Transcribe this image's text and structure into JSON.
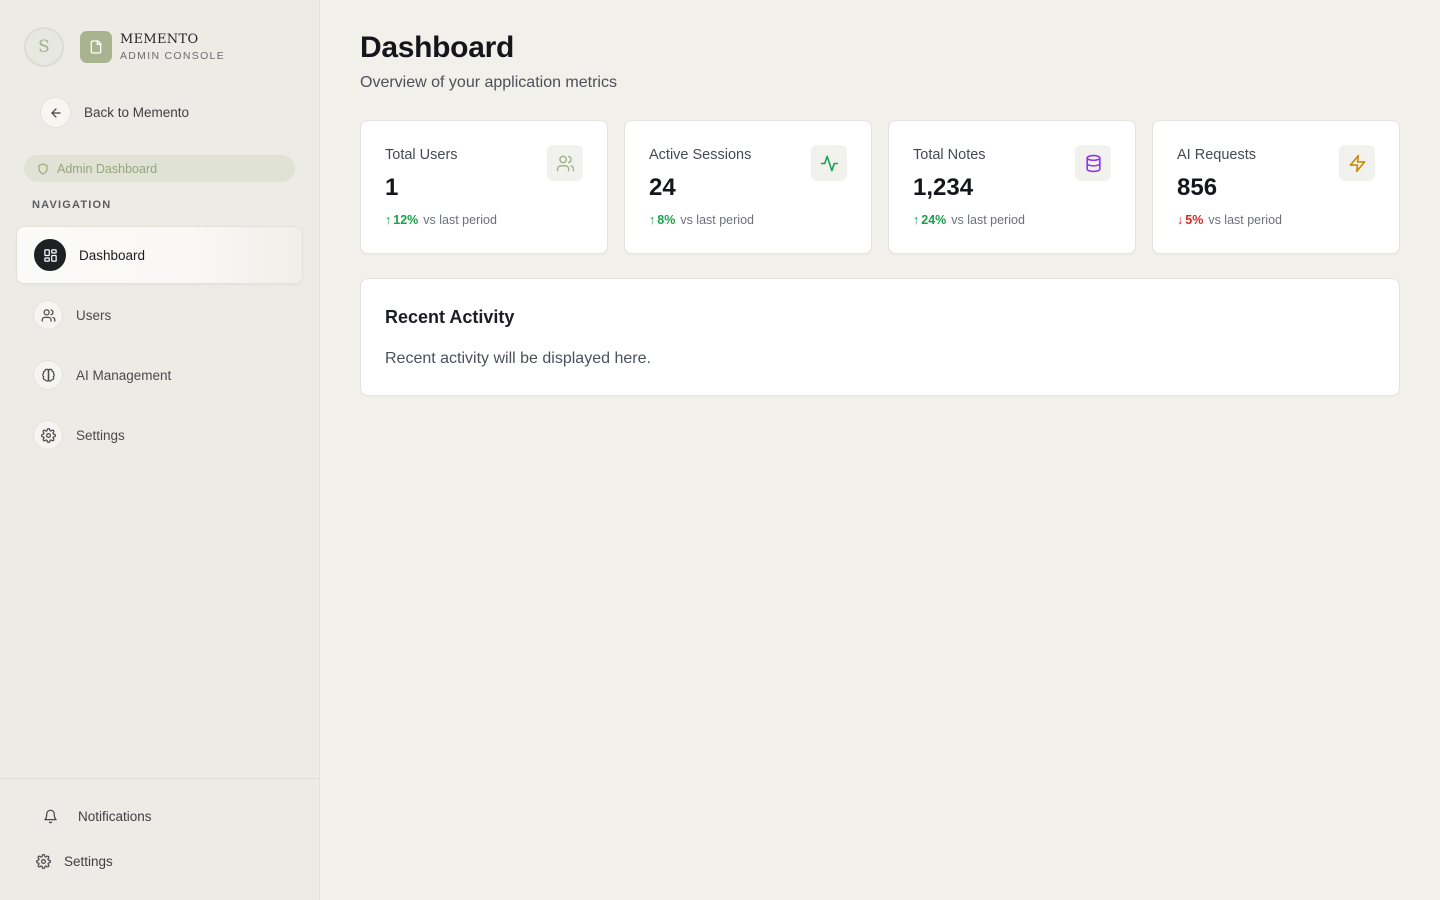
{
  "brand": {
    "avatar_initial": "S",
    "name": "MEMENTO",
    "subtitle": "ADMIN CONSOLE"
  },
  "sidebar": {
    "back_label": "Back to Memento",
    "admin_pill_label": "Admin Dashboard",
    "nav_heading": "NAVIGATION",
    "items": [
      {
        "label": "Dashboard",
        "icon": "dashboard-icon",
        "active": true
      },
      {
        "label": "Users",
        "icon": "users-icon",
        "active": false
      },
      {
        "label": "AI Management",
        "icon": "brain-icon",
        "active": false
      },
      {
        "label": "Settings",
        "icon": "gear-icon",
        "active": false
      }
    ],
    "footer": {
      "notifications_label": "Notifications",
      "settings_label": "Settings"
    }
  },
  "main": {
    "title": "Dashboard",
    "subtitle": "Overview of your application metrics",
    "stats": [
      {
        "label": "Total Users",
        "value": "1",
        "change": "12%",
        "direction": "up",
        "period": "vs last period",
        "icon": "users-icon",
        "icon_color": "#a2b08d"
      },
      {
        "label": "Active Sessions",
        "value": "24",
        "change": "8%",
        "direction": "up",
        "period": "vs last period",
        "icon": "activity-icon",
        "icon_color": "#16a34a"
      },
      {
        "label": "Total Notes",
        "value": "1,234",
        "change": "24%",
        "direction": "up",
        "period": "vs last period",
        "icon": "database-icon",
        "icon_color": "#9333ea"
      },
      {
        "label": "AI Requests",
        "value": "856",
        "change": "5%",
        "direction": "down",
        "period": "vs last period",
        "icon": "lightning-icon",
        "icon_color": "#ca8a04"
      }
    ],
    "activity": {
      "title": "Recent Activity",
      "body": "Recent activity will be displayed here."
    }
  },
  "colors": {
    "up": "#16a34a",
    "down": "#dc2626",
    "accent": "#a7b48f"
  },
  "arrows": {
    "up": "↑",
    "down": "↓"
  }
}
